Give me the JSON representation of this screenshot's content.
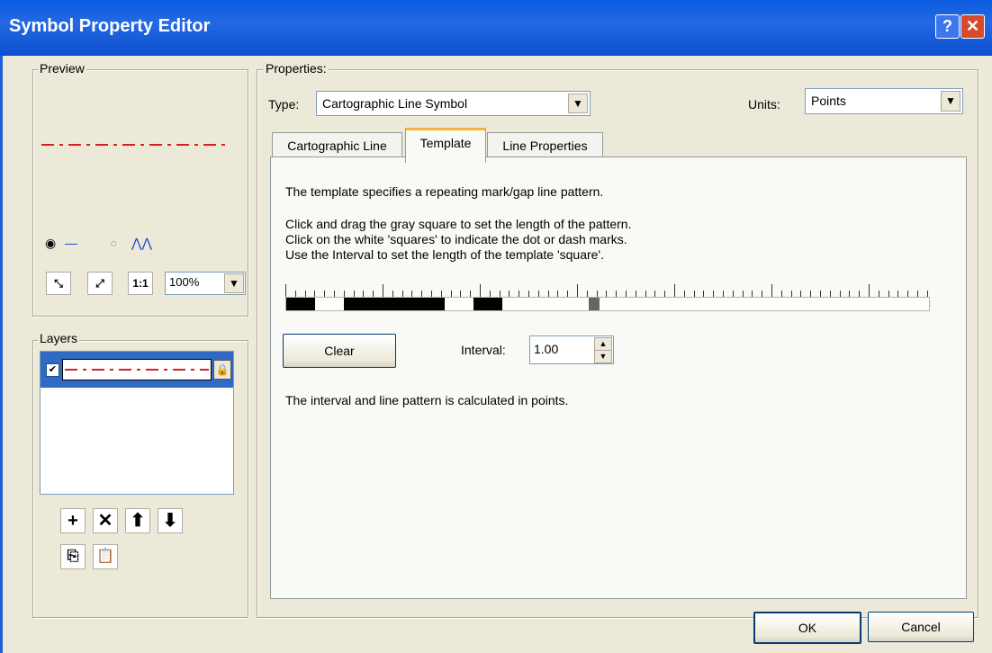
{
  "window": {
    "title": "Symbol Property Editor",
    "help_label": "?",
    "close_label": "✕"
  },
  "preview": {
    "group_label": "Preview",
    "mode_line_label": "—",
    "mode_wave_label": "⋀⋀",
    "zoom": "100%",
    "icons": [
      "zoom-in-icon",
      "zoom-out-icon",
      "actual-size-icon"
    ],
    "line_color": "#d62020"
  },
  "layers": {
    "group_label": "Layers",
    "items": [
      {
        "checked": true,
        "selected": true
      }
    ],
    "buttons": [
      "add-layer",
      "remove-layer",
      "move-up",
      "move-down",
      "copy-layer",
      "paste-layer"
    ],
    "glyphs": {
      "add": "+",
      "remove": "✕",
      "up": "⬆",
      "down": "⬇",
      "copy": "⎘",
      "paste": "📋"
    }
  },
  "properties": {
    "group_label": "Properties:",
    "type_label": "Type:",
    "type_value": "Cartographic Line Symbol",
    "units_label": "Units:",
    "units_value": "Points",
    "tabs": [
      {
        "label": "Cartographic Line",
        "active": false
      },
      {
        "label": "Template",
        "active": true
      },
      {
        "label": "Line Properties",
        "active": false
      }
    ],
    "description": "The template specifies a repeating mark/gap line pattern.",
    "instructions": [
      "Click and drag the gray square to set the length of the pattern.",
      "Click on the white 'squares' to indicate the dot or dash marks.",
      "Use the Interval to set the length of the template 'square'."
    ],
    "template_pattern": [
      1,
      1,
      0,
      0,
      1,
      1,
      1,
      1,
      1,
      1,
      1,
      0,
      0,
      1,
      1,
      0,
      0,
      0,
      0,
      0,
      0
    ],
    "clear_label": "Clear",
    "interval_label": "Interval:",
    "interval_value": "1.00",
    "note": "The interval and line pattern is calculated in points."
  },
  "footer": {
    "ok_label": "OK",
    "cancel_label": "Cancel"
  }
}
